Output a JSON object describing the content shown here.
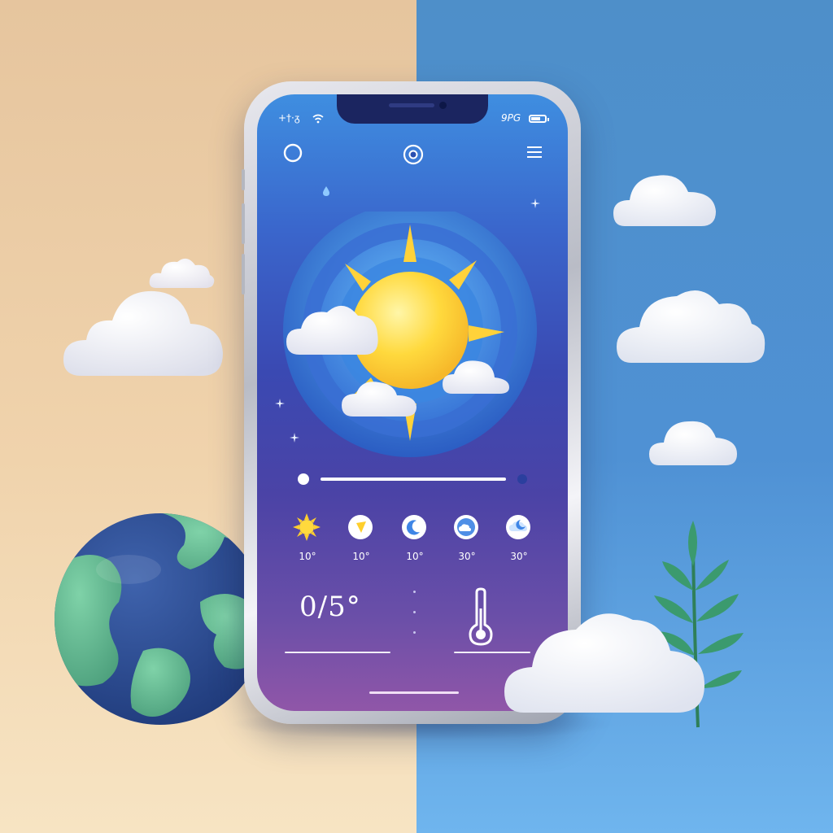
{
  "colors": {
    "left_background": "#f0d3ac",
    "right_background": "#4f91d4",
    "screen_top": "#3f8ee0",
    "screen_bottom": "#9056a8",
    "sun": "#ffd23a",
    "cloud": "#ffffff"
  },
  "status_bar": {
    "left_icons": "+†·ᵹ",
    "time": "9PG",
    "battery_level": 0.8
  },
  "header": {
    "left_icon": "circle-icon",
    "center_icon": "location-target-icon",
    "right_icon": "menu-icon"
  },
  "hero": {
    "icon": "sun-with-clouds-icon"
  },
  "progress": {
    "value": 0.0
  },
  "forecast": [
    {
      "icon": "sun-icon",
      "temp": "10°"
    },
    {
      "icon": "partly-sunny-icon",
      "temp": "10°"
    },
    {
      "icon": "moon-icon",
      "temp": "10°"
    },
    {
      "icon": "moon-cloud-icon",
      "temp": "30°"
    },
    {
      "icon": "cloudy-moon-icon",
      "temp": "30°"
    }
  ],
  "current": {
    "temperature": "0/5°",
    "icon": "thermometer-icon"
  },
  "scene": {
    "globe_icon": "globe-icon",
    "plant_icon": "plant-icon"
  }
}
